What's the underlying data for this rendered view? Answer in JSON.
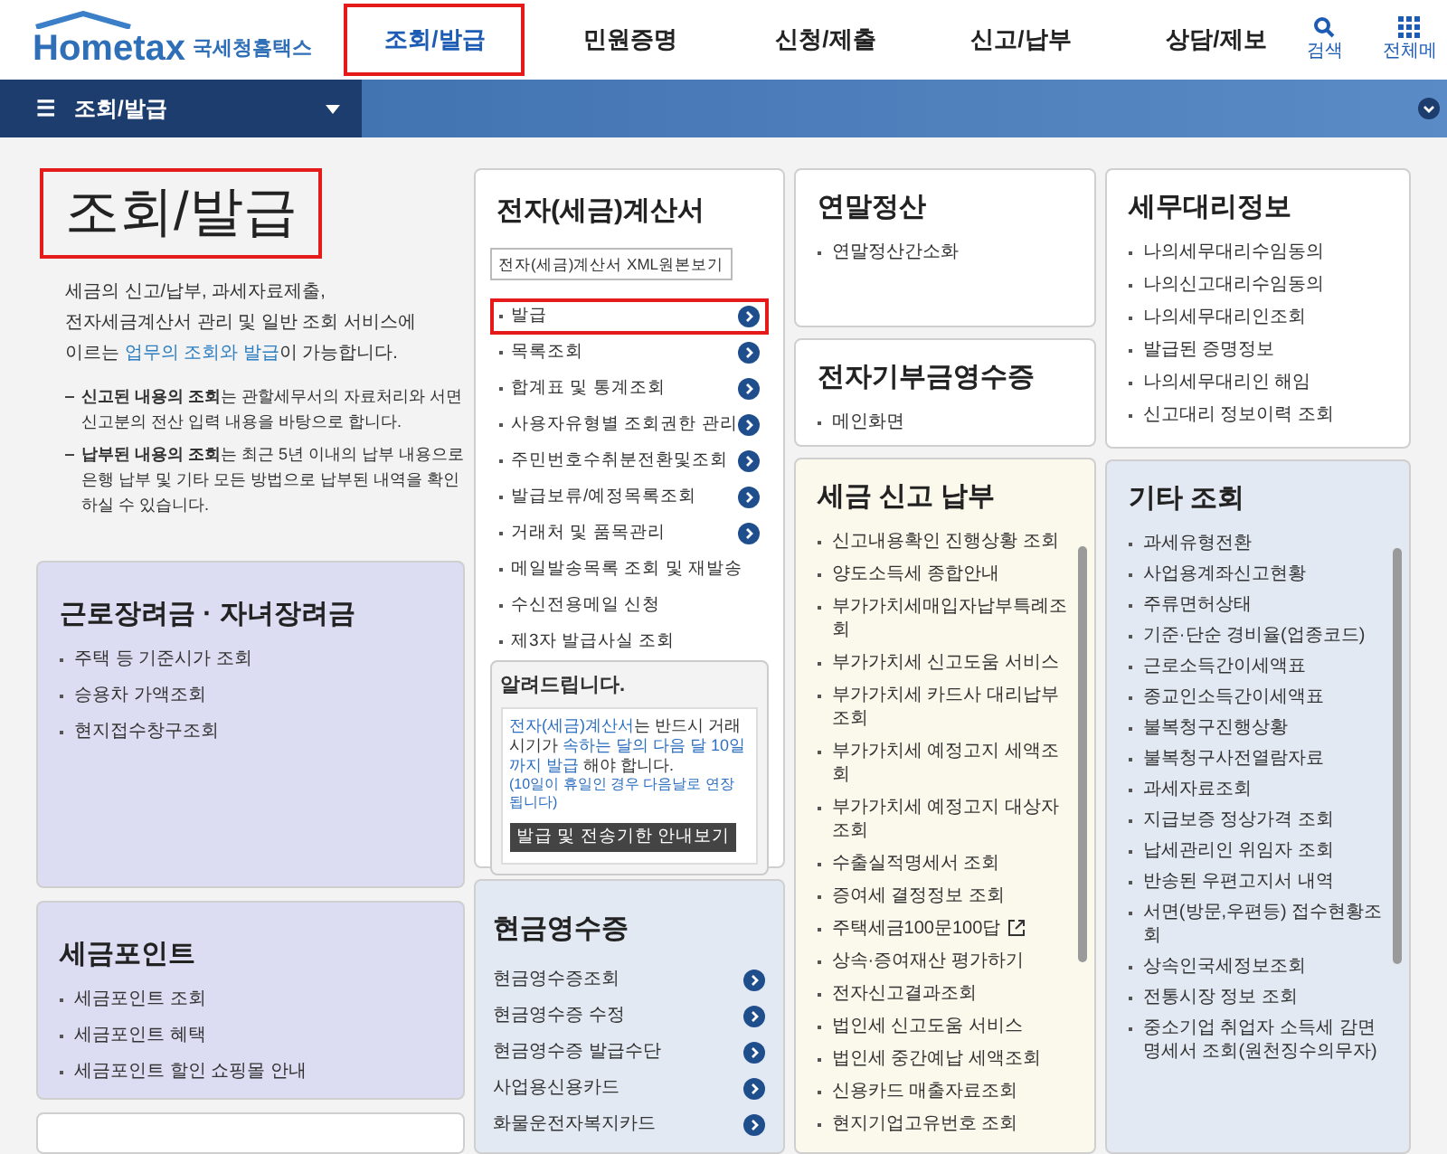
{
  "header": {
    "logo": {
      "brand": "Hometax",
      "name": "국세청홈택스"
    },
    "nav": [
      {
        "label": "조회/발급",
        "selected": true
      },
      {
        "label": "민원증명",
        "selected": false
      },
      {
        "label": "신청/제출",
        "selected": false
      },
      {
        "label": "신고/납부",
        "selected": false
      },
      {
        "label": "상담/제보",
        "selected": false
      }
    ],
    "search": "검색",
    "all_menu": "전체메"
  },
  "breadcrumb": {
    "menu_icon": "☰",
    "label": "조회/발급"
  },
  "intro": {
    "title": "조회/발급",
    "title_highlighted": true,
    "description": [
      {
        "text": "세금의 신고/납부, 과세자료제출,\n전자세금계산서 관리 및 일반 조회 서비스에\n이르는 ",
        "link": false
      },
      {
        "text": "업무의 조회와 발급",
        "link": true
      },
      {
        "text": "이 가능합니다.",
        "link": false
      }
    ],
    "notes": [
      "**신고된 내용의 조회**는 관할세무서의 자료처리와 서면신고분의 전산 입력 내용을 바탕으로 합니다.",
      "**납부된 내용의 조회**는 최근 5년 이내의 납부 내용으로 은행 납부 및 기타 모든 방법으로 납부된 내역을 확인하실 수 있습니다."
    ]
  },
  "cards": {
    "earned_income": {
      "title": "근로장려금 · 자녀장려금",
      "items": [
        "주택 등 기준시가 조회",
        "승용차 가액조회",
        "현지접수창구조회"
      ]
    },
    "tax_point": {
      "title": "세금포인트",
      "items": [
        "세금포인트 조회",
        "세금포인트 혜택",
        "세금포인트 할인 쇼핑몰 안내"
      ]
    },
    "e_invoice": {
      "title": "전자(세금)계산서",
      "xml_button": "전자(세금)계산서 XML원본보기",
      "items": [
        {
          "label": "발급",
          "highlighted": true,
          "has_arrow": true
        },
        {
          "label": "목록조회",
          "highlighted": false,
          "has_arrow": true
        },
        {
          "label": "합계표 및 통계조회",
          "highlighted": false,
          "has_arrow": true
        },
        {
          "label": "사용자유형별 조회권한 관리",
          "highlighted": false,
          "has_arrow": true
        },
        {
          "label": "주민번호수취분전환및조회",
          "highlighted": false,
          "has_arrow": true
        },
        {
          "label": "발급보류/예정목록조회",
          "highlighted": false,
          "has_arrow": true
        },
        {
          "label": "거래처 및 품목관리",
          "highlighted": false,
          "has_arrow": true
        },
        {
          "label": "메일발송목록 조회 및 재발송",
          "highlighted": false,
          "has_arrow": false
        },
        {
          "label": "수신전용메일 신청",
          "highlighted": false,
          "has_arrow": false
        },
        {
          "label": "제3자 발급사실 조회",
          "highlighted": false,
          "has_arrow": false
        }
      ],
      "notice": {
        "title": "알려드립니다.",
        "message": [
          {
            "text": "전자(세금)계산서",
            "emphasis": true
          },
          {
            "text": "는 반드시 거래시기가 ",
            "emphasis": false
          },
          {
            "text": "속하는 달의 다음 달 10일까지 발급",
            "emphasis": true
          },
          {
            "text": " 해야 합니다.",
            "emphasis": false
          }
        ],
        "sub_note": "(10일이 휴일인 경우 다음날로 연장됩니다)",
        "button": "발급 및 전송기한 안내보기"
      }
    },
    "cash_receipt": {
      "title": "현금영수증",
      "items": [
        "현금영수증조회",
        "현금영수증 수정",
        "현금영수증 발급수단",
        "사업용신용카드",
        "화물운전자복지카드"
      ]
    },
    "year_end": {
      "title": "연말정산",
      "items": [
        "연말정산간소화"
      ]
    },
    "donation": {
      "title": "전자기부금영수증",
      "items": [
        "메인화면"
      ]
    },
    "tax_filing": {
      "title": "세금 신고 납부",
      "items": [
        "신고내용확인 진행상황 조회",
        "양도소득세 종합안내",
        "부가가치세매입자납부특례조회",
        "부가가치세 신고도움 서비스",
        "부가가치세 카드사 대리납부 조회",
        "부가가치세 예정고지 세액조회",
        "부가가치세 예정고지 대상자 조회",
        "수출실적명세서 조회",
        "증여세 결정정보 조회",
        {
          "label": "주택세금100문100답",
          "external": true
        },
        "상속·증여재산 평가하기",
        "전자신고결과조회",
        "법인세 신고도움 서비스",
        "법인세 중간예납 세액조회",
        "신용카드 매출자료조회",
        "현지기업고유번호 조회"
      ]
    },
    "tax_agent": {
      "title": "세무대리정보",
      "items": [
        "나의세무대리수임동의",
        "나의신고대리수임동의",
        "나의세무대리인조회",
        "발급된 증명정보",
        "나의세무대리인 해임",
        "신고대리 정보이력 조회"
      ]
    },
    "other": {
      "title": "기타 조회",
      "items": [
        "과세유형전환",
        "사업용계좌신고현황",
        "주류면허상태",
        "기준·단순 경비율(업종코드)",
        "근로소득간이세액표",
        "종교인소득간이세액표",
        "불복청구진행상황",
        "불복청구사전열람자료",
        "과세자료조회",
        "지급보증 정상가격 조회",
        "납세관리인 위임자 조회",
        "반송된 우편고지서 내역",
        "서면(방문,우편등) 접수현황조회",
        "상속인국세정보조회",
        "전통시장 정보 조회",
        "중소기업 취업자 소득세 감면 명세서 조회(원천징수의무자)"
      ]
    }
  }
}
